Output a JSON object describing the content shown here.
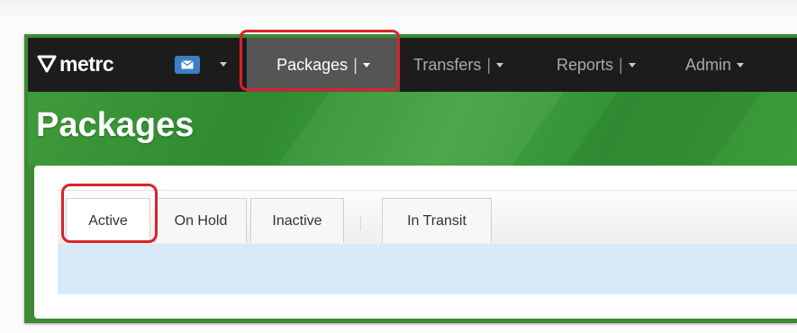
{
  "brand": {
    "name": "metrc"
  },
  "nav": {
    "mail_icon": "envelope-icon",
    "items": [
      {
        "label": "Packages",
        "sep": "|"
      },
      {
        "label": "Transfers",
        "sep": "|"
      },
      {
        "label": "Reports",
        "sep": "|"
      },
      {
        "label": "Admin"
      }
    ]
  },
  "page": {
    "title": "Packages"
  },
  "tabs": [
    {
      "label": "Active"
    },
    {
      "label": "On Hold"
    },
    {
      "label": "Inactive"
    },
    {
      "label": "In Transit"
    }
  ],
  "colors": {
    "nav_bg": "#1c1c1c",
    "banner_green": "#3f9b3a",
    "highlight_red": "#d8232a",
    "grid_blue": "#d8eaf8"
  }
}
